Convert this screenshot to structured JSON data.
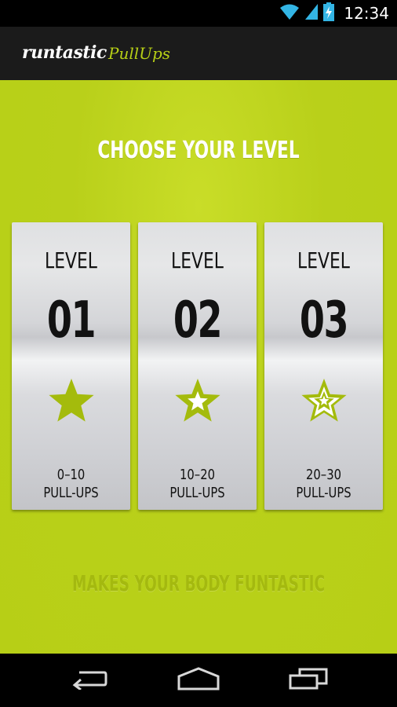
{
  "status_bar": {
    "time": "12:34",
    "icons": [
      "wifi-icon",
      "signal-icon",
      "battery-charging-icon"
    ]
  },
  "app_bar": {
    "logo_main": "runtastic",
    "logo_sub": "PullUps"
  },
  "main": {
    "title": "CHOOSE YOUR LEVEL",
    "levels": [
      {
        "label": "LEVEL",
        "number": "01",
        "range": "0–10",
        "unit": "PULL-UPS",
        "icon": "star-filled-icon"
      },
      {
        "label": "LEVEL",
        "number": "02",
        "range": "10–20",
        "unit": "PULL-UPS",
        "icon": "star-outline-icon"
      },
      {
        "label": "LEVEL",
        "number": "03",
        "range": "20–30",
        "unit": "PULL-UPS",
        "icon": "star-double-outline-icon"
      }
    ],
    "tagline": "MAKES YOUR BODY FUNTASTIC"
  },
  "nav_bar": {
    "buttons": [
      "back-icon",
      "home-icon",
      "recent-apps-icon"
    ]
  },
  "colors": {
    "accent": "#b7cf16",
    "star": "#a4bb0c",
    "bar": "#1b1b1b"
  }
}
